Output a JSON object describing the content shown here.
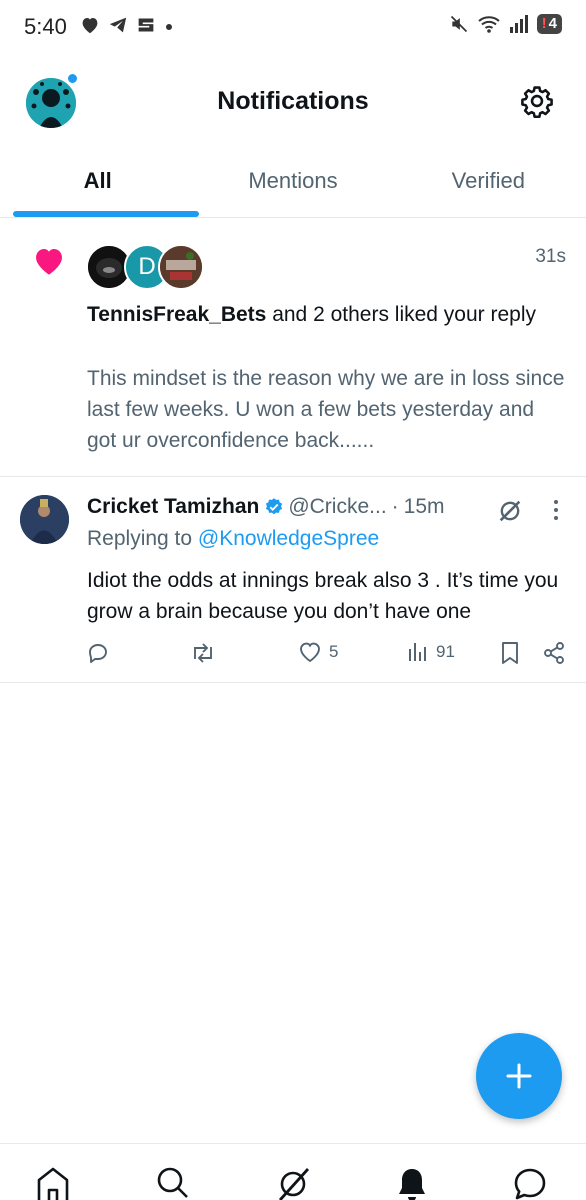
{
  "status_bar": {
    "time": "5:40",
    "left_icons": [
      "heart-icon",
      "telegram-icon",
      "app-icon",
      "dot-icon"
    ],
    "right_icons": [
      "mute-icon",
      "wifi-icon",
      "signal-icon"
    ],
    "battery_badge": "4"
  },
  "header": {
    "title": "Notifications",
    "settings_icon": "gear-icon"
  },
  "tabs": [
    {
      "label": "All",
      "active": true
    },
    {
      "label": "Mentions",
      "active": false
    },
    {
      "label": "Verified",
      "active": false
    }
  ],
  "like_notification": {
    "icon": "heart-icon",
    "avatar_letter": "D",
    "time": "31s",
    "user": "TennisFreak_Bets",
    "action_text": " and 2 others liked your reply",
    "quote": "This mindset is the reason why we are in loss since last few weeks. U won a few bets yesterday and got ur overconfidence back......"
  },
  "reply_tweet": {
    "name": "Cricket Tamizhan",
    "handle": "@Cricke...",
    "separator": "·",
    "time": "15m",
    "replying_prefix": "Replying to ",
    "replying_to": "@KnowledgeSpree",
    "body": "Idiot the odds at innings break also 3 . It’s time you grow a brain because you don’t have one",
    "actions": {
      "replies": "",
      "reposts": "",
      "likes": "5",
      "views": "91"
    }
  },
  "bottom_nav": [
    "home-icon",
    "search-icon",
    "grok-icon",
    "notifications-icon",
    "messages-icon"
  ],
  "colors": {
    "accent": "#1d9bf0",
    "like": "#f91880",
    "text_primary": "#0f1419",
    "text_secondary": "#536471"
  }
}
